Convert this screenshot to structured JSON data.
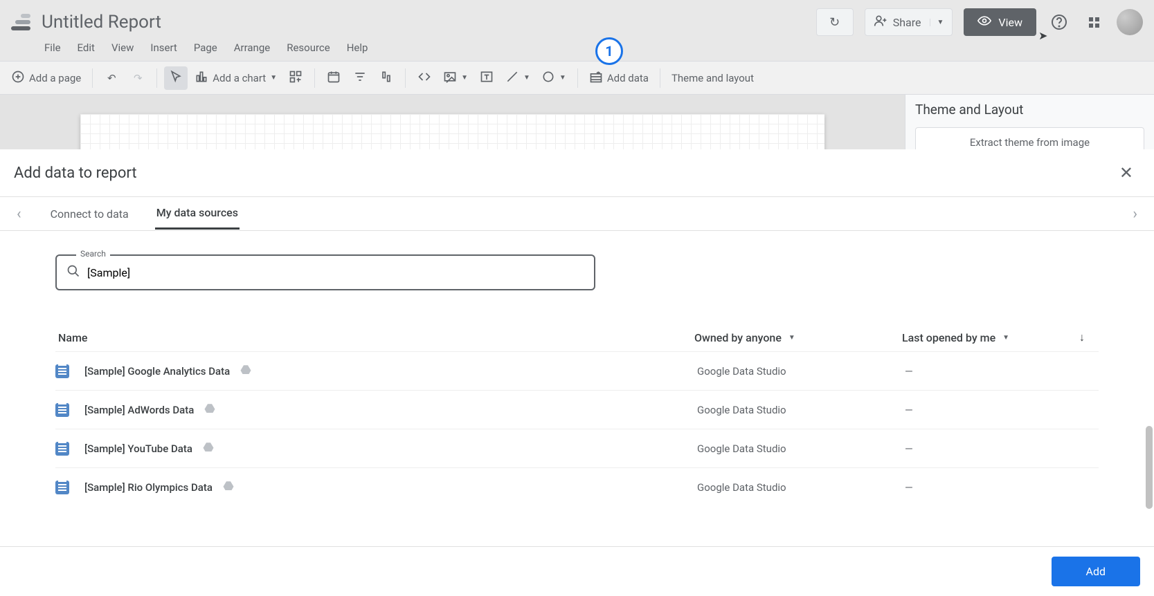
{
  "header": {
    "title": "Untitled Report",
    "menus": [
      "File",
      "Edit",
      "View",
      "Insert",
      "Page",
      "Arrange",
      "Resource",
      "Help"
    ],
    "share_label": "Share",
    "view_label": "View"
  },
  "toolbar": {
    "add_page": "Add a page",
    "add_chart": "Add a chart",
    "add_data": "Add data",
    "theme_layout": "Theme and layout"
  },
  "side_panel": {
    "title": "Theme and Layout",
    "extract_btn": "Extract theme from image"
  },
  "callout": {
    "number": "1"
  },
  "panel": {
    "title": "Add data to report",
    "tabs": {
      "connect": "Connect to data",
      "mysources": "My data sources"
    },
    "search_label": "Search",
    "search_value": "[Sample]",
    "columns": {
      "name": "Name",
      "owner": "Owned by anyone",
      "opened": "Last opened by me"
    },
    "rows": [
      {
        "name": "[Sample] Google Analytics Data",
        "owner": "Google Data Studio",
        "opened": "—"
      },
      {
        "name": "[Sample] AdWords Data",
        "owner": "Google Data Studio",
        "opened": "—"
      },
      {
        "name": "[Sample] YouTube Data",
        "owner": "Google Data Studio",
        "opened": "—"
      },
      {
        "name": "[Sample] Rio Olympics Data",
        "owner": "Google Data Studio",
        "opened": "—"
      }
    ],
    "add_btn": "Add"
  }
}
